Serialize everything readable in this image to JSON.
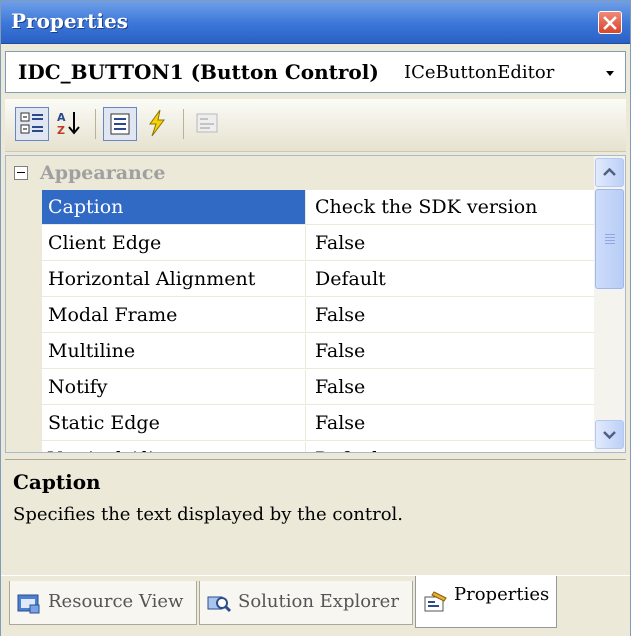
{
  "window": {
    "title": "Properties"
  },
  "object_selector": {
    "object_name": "IDC_BUTTON1 (Button Control)",
    "object_type": "ICeButtonEditor"
  },
  "toolbar": {
    "buttons": [
      {
        "icon": "categorized-icon",
        "checked": true
      },
      {
        "icon": "alphabetical-icon",
        "checked": false
      },
      {
        "icon": "properties-icon",
        "checked": true
      },
      {
        "icon": "events-icon",
        "checked": false
      },
      {
        "icon": "property-pages-icon",
        "checked": false,
        "disabled": true
      }
    ]
  },
  "grid": {
    "category": "Appearance",
    "rows": [
      {
        "name": "Caption",
        "value": "Check the SDK version",
        "selected": true
      },
      {
        "name": "Client Edge",
        "value": "False"
      },
      {
        "name": "Horizontal Alignment",
        "value": "Default"
      },
      {
        "name": "Modal Frame",
        "value": "False"
      },
      {
        "name": "Multiline",
        "value": "False"
      },
      {
        "name": "Notify",
        "value": "False"
      },
      {
        "name": "Static Edge",
        "value": "False"
      },
      {
        "name": "Vertical Alignment",
        "value": "Default"
      }
    ]
  },
  "description": {
    "title": "Caption",
    "text": "Specifies the text displayed by the control."
  },
  "tabs": [
    {
      "label": "Resource View",
      "icon": "resource-view-icon",
      "active": false
    },
    {
      "label": "Solution Explorer",
      "icon": "solution-explorer-icon",
      "active": false
    },
    {
      "label": "Properties",
      "icon": "properties-tab-icon",
      "active": true
    }
  ],
  "colors": {
    "title_bar": "#3b76d8",
    "selection": "#316ac5",
    "panel": "#ece9d8"
  }
}
